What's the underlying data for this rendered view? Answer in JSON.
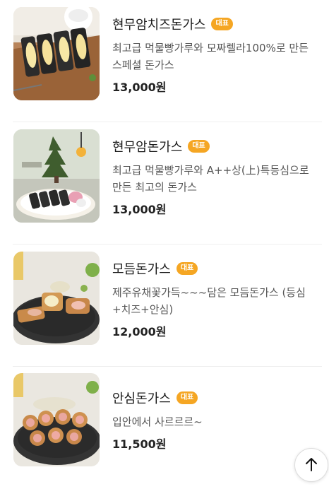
{
  "menu": {
    "items": [
      {
        "name": "현무암치즈돈가스",
        "badge": "대표",
        "description": "최고급 먹물빵가루와 모짜렐라100%로 만든 스페셜 돈가스",
        "price": "13,000원",
        "image": "black-cheese-katsu-photo"
      },
      {
        "name": "현무암돈가스",
        "badge": "대표",
        "description": "최고급 먹물빵가루와 A++상(上)특등심으로 만든 최고의 돈가스",
        "price": "13,000원",
        "image": "black-katsu-restaurant-photo"
      },
      {
        "name": "모듬돈가스",
        "badge": "대표",
        "description": "제주유채꽃가득~~~담은 모듬돈가스 (등심+치즈+안심)",
        "price": "12,000원",
        "image": "assorted-katsu-photo"
      },
      {
        "name": "안심돈가스",
        "badge": "대표",
        "description": "입안에서 사르르르~",
        "price": "11,500원",
        "image": "tenderloin-katsu-photo"
      }
    ]
  },
  "scroll_top_icon": "arrow-up-icon",
  "colors": {
    "badge": "#f5a623",
    "divider": "#eeeeee"
  }
}
